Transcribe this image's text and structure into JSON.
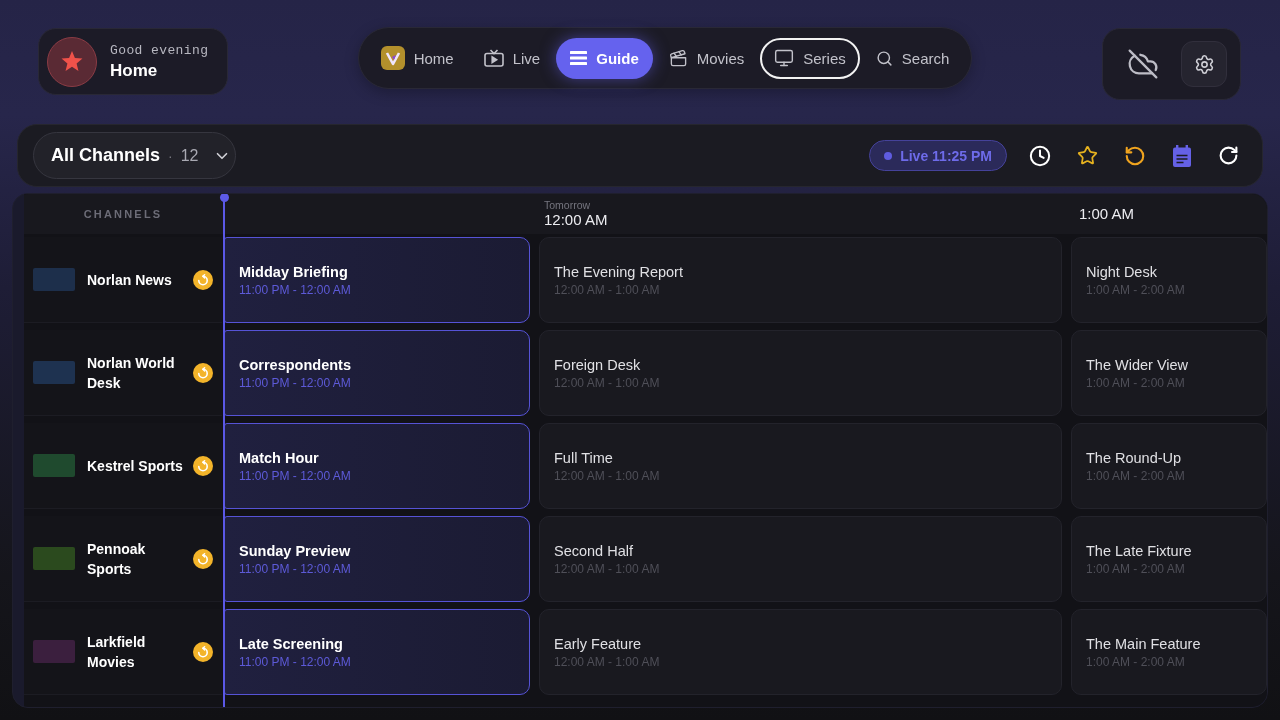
{
  "greeting": {
    "subtitle": "Good evening",
    "title": "Home"
  },
  "nav": [
    {
      "label": "Home",
      "selected": false,
      "focused": false
    },
    {
      "label": "Live",
      "selected": false,
      "focused": false
    },
    {
      "label": "Guide",
      "selected": true,
      "focused": false
    },
    {
      "label": "Movies",
      "selected": false,
      "focused": false
    },
    {
      "label": "Series",
      "selected": false,
      "focused": true
    },
    {
      "label": "Search",
      "selected": false,
      "focused": false
    }
  ],
  "filter": {
    "label": "All Channels",
    "separator": "·",
    "count": "12"
  },
  "live_badge": {
    "label": "Live 11:25 PM"
  },
  "guide": {
    "channels_header": "CHANNELS",
    "timeline": [
      {
        "day": "Tomorrow",
        "time": "12:00 AM"
      },
      {
        "time": "1:00 AM"
      }
    ],
    "channels": [
      {
        "name": "Norlan News",
        "color": "#1d2f4b",
        "catchup": true,
        "programs": [
          {
            "title": "Midday Briefing",
            "time": "11:00 PM - 12:00 AM",
            "live": true
          },
          {
            "title": "The Evening Report",
            "time": "12:00 AM - 1:00 AM",
            "live": false
          },
          {
            "title": "Night Desk",
            "time": "1:00 AM - 2:00 AM",
            "live": false
          }
        ]
      },
      {
        "name": "Norlan World Desk",
        "color": "#1e3250",
        "catchup": true,
        "programs": [
          {
            "title": "Correspondents",
            "time": "11:00 PM - 12:00 AM",
            "live": true
          },
          {
            "title": "Foreign Desk",
            "time": "12:00 AM - 1:00 AM",
            "live": false
          },
          {
            "title": "The Wider View",
            "time": "1:00 AM - 2:00 AM",
            "live": false
          }
        ]
      },
      {
        "name": "Kestrel Sports",
        "color": "#1f4a2e",
        "catchup": true,
        "programs": [
          {
            "title": "Match Hour",
            "time": "11:00 PM - 12:00 AM",
            "live": true
          },
          {
            "title": "Full Time",
            "time": "12:00 AM - 1:00 AM",
            "live": false
          },
          {
            "title": "The Round-Up",
            "time": "1:00 AM - 2:00 AM",
            "live": false
          }
        ]
      },
      {
        "name": "Pennoak Sports",
        "color": "#2b4a1e",
        "catchup": true,
        "programs": [
          {
            "title": "Sunday Preview",
            "time": "11:00 PM - 12:00 AM",
            "live": true
          },
          {
            "title": "Second Half",
            "time": "12:00 AM - 1:00 AM",
            "live": false
          },
          {
            "title": "The Late Fixture",
            "time": "1:00 AM - 2:00 AM",
            "live": false
          }
        ]
      },
      {
        "name": "Larkfield Movies",
        "color": "#3b1f3e",
        "catchup": true,
        "programs": [
          {
            "title": "Late Screening",
            "time": "11:00 PM - 12:00 AM",
            "live": true
          },
          {
            "title": "Early Feature",
            "time": "12:00 AM - 1:00 AM",
            "live": false
          },
          {
            "title": "The Main Feature",
            "time": "1:00 AM - 2:00 AM",
            "live": false
          }
        ]
      }
    ]
  }
}
